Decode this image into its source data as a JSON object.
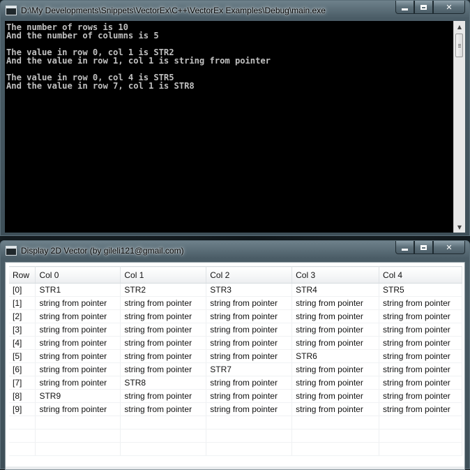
{
  "console_window": {
    "title": "D:\\My Developments\\Snippets\\VectorEx\\C++\\VectorEx Examples\\Debug\\main.exe",
    "lines": [
      "The number of rows is 10",
      "And the number of columns is 5",
      "",
      "The value in row 0, col 1 is STR2",
      "And the value in row 1, col 1 is string from pointer",
      "",
      "The value in row 0, col 4 is STR5",
      "And the value in row 7, col 1 is STR8"
    ],
    "scroll_up_glyph": "▲",
    "scroll_down_glyph": "▼"
  },
  "grid_window": {
    "title": "Display 2D Vector (by gileli121@gmail.com)",
    "columns": [
      "Row",
      "Col 0",
      "Col 1",
      "Col 2",
      "Col 3",
      "Col 4"
    ],
    "rows": [
      [
        "[0]",
        "STR1",
        "STR2",
        "STR3",
        "STR4",
        "STR5"
      ],
      [
        "[1]",
        "string from pointer",
        "string from pointer",
        "string from pointer",
        "string from pointer",
        "string from pointer"
      ],
      [
        "[2]",
        "string from pointer",
        "string from pointer",
        "string from pointer",
        "string from pointer",
        "string from pointer"
      ],
      [
        "[3]",
        "string from pointer",
        "string from pointer",
        "string from pointer",
        "string from pointer",
        "string from pointer"
      ],
      [
        "[4]",
        "string from pointer",
        "string from pointer",
        "string from pointer",
        "string from pointer",
        "string from pointer"
      ],
      [
        "[5]",
        "string from pointer",
        "string from pointer",
        "string from pointer",
        "STR6",
        "string from pointer"
      ],
      [
        "[6]",
        "string from pointer",
        "string from pointer",
        "STR7",
        "string from pointer",
        "string from pointer"
      ],
      [
        "[7]",
        "string from pointer",
        "STR8",
        "string from pointer",
        "string from pointer",
        "string from pointer"
      ],
      [
        "[8]",
        "STR9",
        "string from pointer",
        "string from pointer",
        "string from pointer",
        "string from pointer"
      ],
      [
        "[9]",
        "string from pointer",
        "string from pointer",
        "string from pointer",
        "string from pointer",
        "string from pointer"
      ]
    ]
  },
  "caption_buttons": {
    "close_glyph": "✕"
  },
  "colors": {
    "console_background": "#000000",
    "console_text": "#c0c0c0",
    "grid_background": "#ffffff",
    "window_frame": "#4a5c66"
  }
}
